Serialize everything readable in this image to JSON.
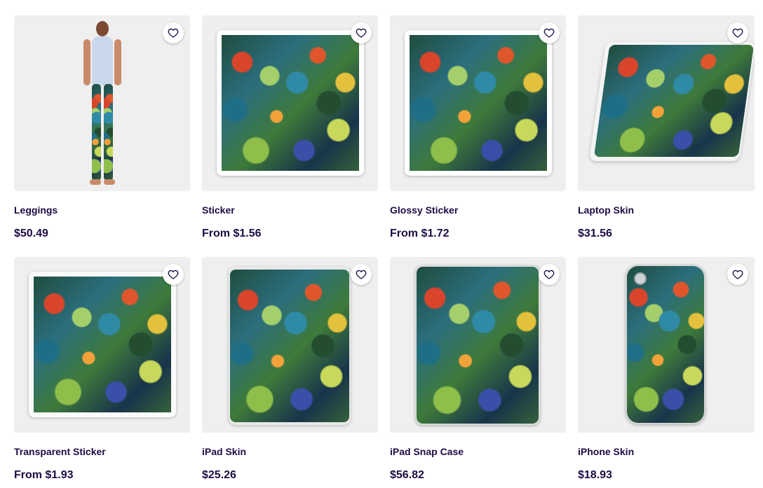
{
  "products": [
    {
      "title": "Leggings",
      "price": "$50.49",
      "type": "leggings"
    },
    {
      "title": "Sticker",
      "price": "From $1.56",
      "type": "sticker"
    },
    {
      "title": "Glossy Sticker",
      "price": "From $1.72",
      "type": "sticker"
    },
    {
      "title": "Laptop Skin",
      "price": "$31.56",
      "type": "laptop"
    },
    {
      "title": "Transparent Sticker",
      "price": "From $1.93",
      "type": "transparent"
    },
    {
      "title": "iPad Skin",
      "price": "$25.26",
      "type": "ipad"
    },
    {
      "title": "iPad Snap Case",
      "price": "$56.82",
      "type": "ipadcase"
    },
    {
      "title": "iPhone Skin",
      "price": "$18.93",
      "type": "iphone"
    }
  ],
  "icons": {
    "favorite": "heart-outline-icon"
  },
  "colors": {
    "text": "#1e0b44",
    "thumb_bg": "#efefef"
  }
}
